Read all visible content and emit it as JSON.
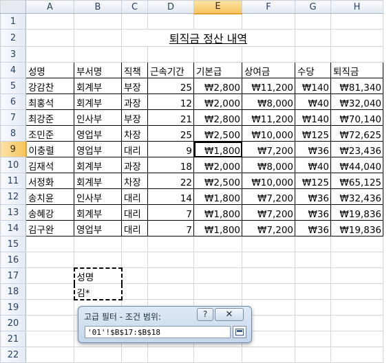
{
  "sheet": {
    "columns": [
      "A",
      "B",
      "C",
      "D",
      "E",
      "F",
      "G",
      "H"
    ],
    "active_column": "E",
    "active_row": 9,
    "title": "퇴직금 정산 내역",
    "headers": [
      "성명",
      "부서명",
      "직책",
      "근속기간",
      "기본급",
      "상여금",
      "수당",
      "퇴직금"
    ],
    "rows": [
      [
        "강감찬",
        "회계부",
        "부장",
        "25",
        "₩2,800",
        "₩11,200",
        "₩140",
        "₩81,340"
      ],
      [
        "최홍석",
        "회계부",
        "과장",
        "12",
        "₩2,000",
        "₩8,000",
        "₩40",
        "₩32,040"
      ],
      [
        "최강준",
        "인사부",
        "부장",
        "21",
        "₩2,800",
        "₩11,200",
        "₩140",
        "₩70,140"
      ],
      [
        "조민준",
        "영업부",
        "차장",
        "25",
        "₩2,500",
        "₩10,000",
        "₩125",
        "₩72,625"
      ],
      [
        "이충렬",
        "영업부",
        "대리",
        "9",
        "₩1,800",
        "₩7,200",
        "₩36",
        "₩23,436"
      ],
      [
        "김재석",
        "회계부",
        "과장",
        "18",
        "₩2,000",
        "₩8,000",
        "₩40",
        "₩44,040"
      ],
      [
        "서정화",
        "회계부",
        "차장",
        "22",
        "₩2,500",
        "₩10,000",
        "₩125",
        "₩65,125"
      ],
      [
        "송치윤",
        "인사부",
        "대리",
        "14",
        "₩1,800",
        "₩7,200",
        "₩36",
        "₩32,436"
      ],
      [
        "송혜강",
        "회계부",
        "대리",
        "7",
        "₩1,800",
        "₩7,200",
        "₩36",
        "₩19,836"
      ],
      [
        "김구완",
        "영업부",
        "대리",
        "7",
        "₩1,800",
        "₩7,200",
        "₩36",
        "₩19,836"
      ]
    ],
    "criteria_header": "성명",
    "criteria_value": "김*"
  },
  "dialog": {
    "title": "고급 필터 - 조건 범위:",
    "help_label": "?",
    "close_label": "✕",
    "range_value": "'01'!$B$17:$B$18"
  },
  "colors": {
    "active_header": "#f6c35b",
    "header_bg": "#e3e9f2"
  }
}
